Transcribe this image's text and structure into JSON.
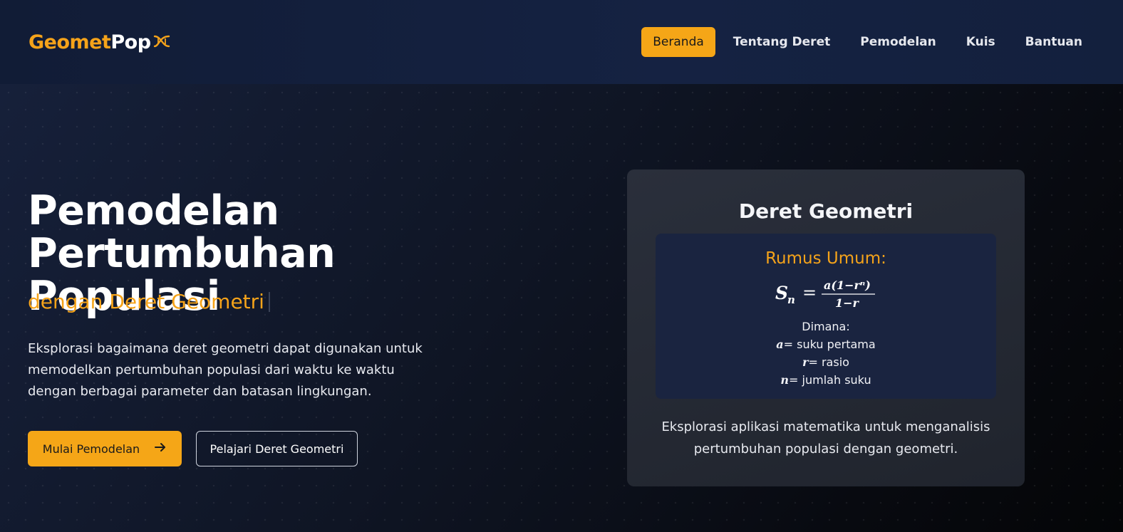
{
  "logo": {
    "brand_part1": "Geomet",
    "brand_part2": "Pop"
  },
  "nav": {
    "items": [
      {
        "label": "Beranda",
        "active": true
      },
      {
        "label": "Tentang Deret",
        "active": false
      },
      {
        "label": "Pemodelan",
        "active": false
      },
      {
        "label": "Kuis",
        "active": false
      },
      {
        "label": "Bantuan",
        "active": false
      }
    ]
  },
  "hero": {
    "title_line1": "Pemodelan Pertumbuhan",
    "title_line2": "Populasi",
    "subtitle": "dengan Deret Geometri",
    "description": "Eksplorasi bagaimana deret geometri dapat digunakan untuk memodelkan pertumbuhan populasi dari waktu ke waktu dengan berbagai parameter dan batasan lingkungan.",
    "primary_button": "Mulai Pemodelan",
    "secondary_button": "Pelajari Deret Geometri"
  },
  "card": {
    "title": "Deret Geometri",
    "formula_heading": "Rumus Umum:",
    "formula": {
      "lhs_symbol": "S",
      "lhs_subscript": "n",
      "numerator": "a(1−rⁿ)",
      "denominator": "1−r"
    },
    "where_label": "Dimana:",
    "variables": [
      {
        "symbol": "a",
        "meaning": "= suku pertama"
      },
      {
        "symbol": "r",
        "meaning": "= rasio"
      },
      {
        "symbol": "n",
        "meaning": "= jumlah suku"
      }
    ],
    "description": "Eksplorasi aplikasi matematika untuk menganalisis pertumbuhan populasi dengan geometri."
  },
  "colors": {
    "accent": "#f5a617",
    "header_bg": "#13203d",
    "card_bg": "#252a35",
    "formula_bg": "#1a2440"
  },
  "icons": {
    "logo_icon": "dna-icon",
    "primary_button_icon": "arrow-right-icon"
  }
}
